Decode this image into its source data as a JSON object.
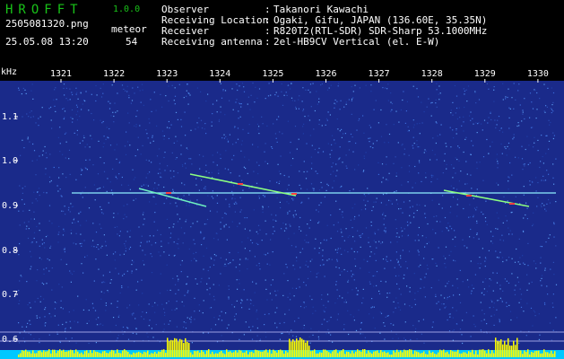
{
  "header": {
    "app_name": "HROFFT",
    "app_version": "1.0.0",
    "filename": "2505081320.png",
    "meteor_label": "meteor",
    "datetime": "25.05.08 13:20",
    "meteor_count": "54",
    "info": [
      {
        "label": "Observer",
        "value": "Takanori Kawachi"
      },
      {
        "label": "Receiving Location",
        "value": "Ogaki, Gifu, JAPAN (136.60E, 35.35N)"
      },
      {
        "label": "Receiver",
        "value": "R820T2(RTL-SDR) SDR-Sharp 53.1000MHz"
      },
      {
        "label": "Receiving antenna",
        "value": "2el-HB9CV Vertical (el. E-W)"
      }
    ]
  },
  "spectrogram": {
    "y_unit": "kHz",
    "x_ticks": [
      "1321",
      "1322",
      "1323",
      "1324",
      "1325",
      "1326",
      "1327",
      "1328",
      "1329",
      "1330"
    ],
    "y_ticks": [
      "1.1",
      "1.0",
      "0.9",
      "0.8",
      "0.7",
      "0.6"
    ],
    "colors": {
      "background": "#1a2a8a",
      "noise": "#3a6ad8",
      "axis_text": "#ffffff",
      "level_bars": "#ffff00",
      "base_band": "#00c8ff"
    }
  }
}
